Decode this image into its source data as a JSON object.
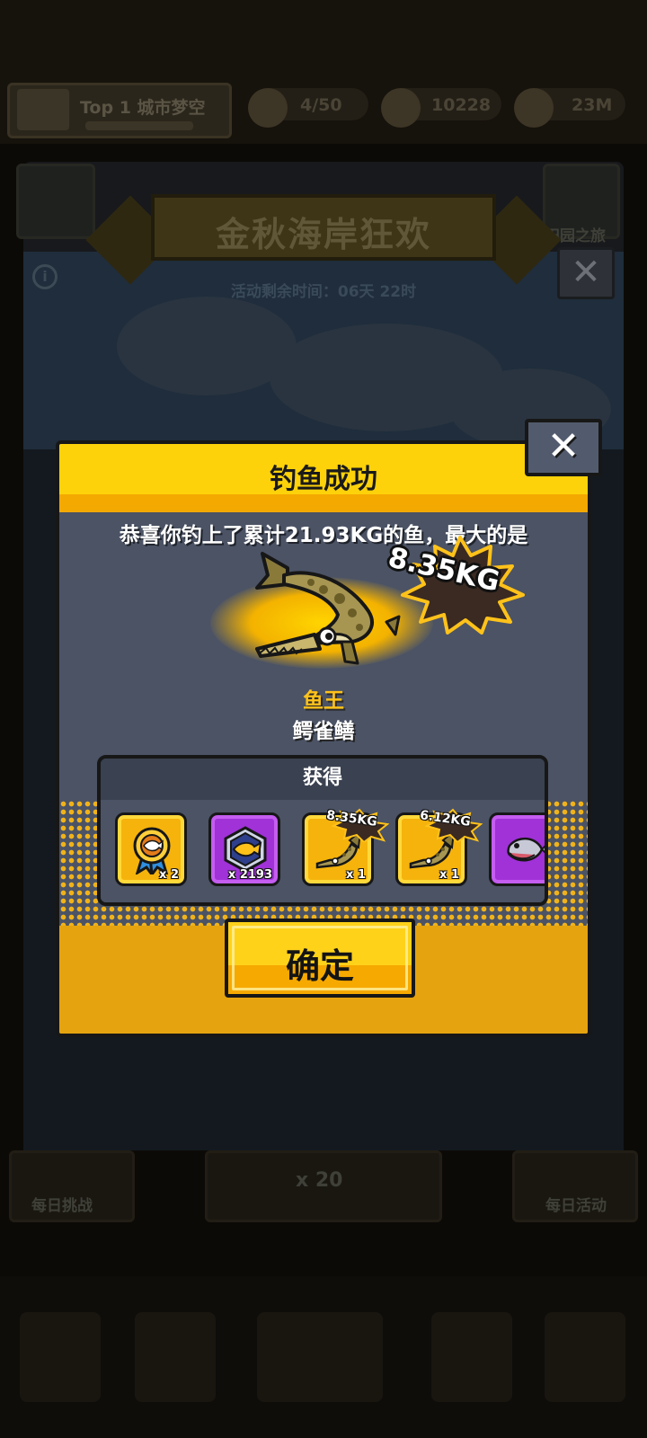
{
  "topbar": {
    "rank_label": "Top 1 城市梦空",
    "resources": [
      {
        "value": "4/50",
        "icon": "fish-hook-icon"
      },
      {
        "value": "10228",
        "icon": "coin-icon"
      },
      {
        "value": "23M",
        "icon": "gold-bag-icon"
      }
    ]
  },
  "event": {
    "title": "金秋海岸狂欢",
    "timer": "活动剩余时间：06天 22时",
    "close_symbol": "✕",
    "info_symbol": "i",
    "side_label_right": "田园之旅"
  },
  "bottom": {
    "left_tab": "每日挑战",
    "center_tab": "x 20",
    "right_tab": "每日活动"
  },
  "dialog": {
    "title": "钓鱼成功",
    "close_symbol": "✕",
    "congrats": "恭喜你钓上了累计21.93KG的鱼，最大的是",
    "biggest_weight": "8.35KG",
    "fish_rank": "鱼王",
    "fish_name": "鳄雀鳝",
    "rewards_title": "获得",
    "rewards": [
      {
        "type": "medal",
        "count": "x 2",
        "tag": "",
        "icon": "fish-medal-icon",
        "color": "gold"
      },
      {
        "type": "fish-card",
        "count": "x 2193",
        "tag": "",
        "icon": "fish-gem-icon",
        "color": "purple"
      },
      {
        "type": "fish",
        "count": "x 1",
        "tag": "8.35KG",
        "icon": "alligator-gar-icon",
        "color": "gold"
      },
      {
        "type": "fish",
        "count": "x 1",
        "tag": "6.12KG",
        "icon": "alligator-gar-icon",
        "color": "gold"
      },
      {
        "type": "fish",
        "count": "",
        "tag": "",
        "icon": "piranha-icon",
        "color": "purple"
      }
    ],
    "confirm_label": "确定"
  },
  "colors": {
    "dialog_bg": "#4b5365",
    "header_yellow": "#fdd20a",
    "accent_orange": "#f4a900",
    "rank_gold": "#ffc21a",
    "purple_item": "#a032d8"
  }
}
